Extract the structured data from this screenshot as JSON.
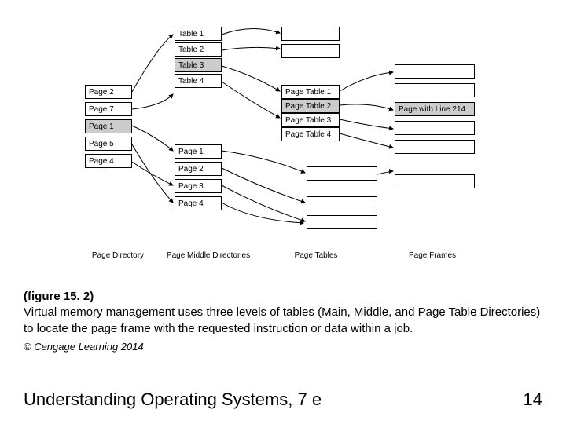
{
  "directory": {
    "label": "Page Directory",
    "items": [
      "Page 2",
      "Page 7",
      "Page 1",
      "Page 5",
      "Page 4"
    ],
    "shaded": [
      2
    ]
  },
  "middleA": {
    "items": [
      "Table 1",
      "Table 2",
      "Table 3",
      "Table 4"
    ],
    "shaded": [
      2
    ]
  },
  "middleB": {
    "items": [
      "Page 1",
      "Page 2",
      "Page 3",
      "Page 4"
    ]
  },
  "middleLabel": "Page Middle Directories",
  "pageTables": {
    "label": "Page Tables",
    "items": [
      "Page Table 1",
      "Page Table 2",
      "Page Table 3",
      "Page Table 4"
    ],
    "shaded": [
      1
    ]
  },
  "frameTarget": "Page with Line 214",
  "framesLabel": "Page Frames",
  "caption": {
    "fig": "(figure 15. 2)",
    "text": "Virtual memory management uses three levels of tables (Main, Middle, and Page Table Directories) to locate the page frame with the requested instruction or data within a job.",
    "copy": "© Cengage Learning 2014"
  },
  "footer": {
    "title": "Understanding Operating Systems, 7 e",
    "page": "14"
  }
}
